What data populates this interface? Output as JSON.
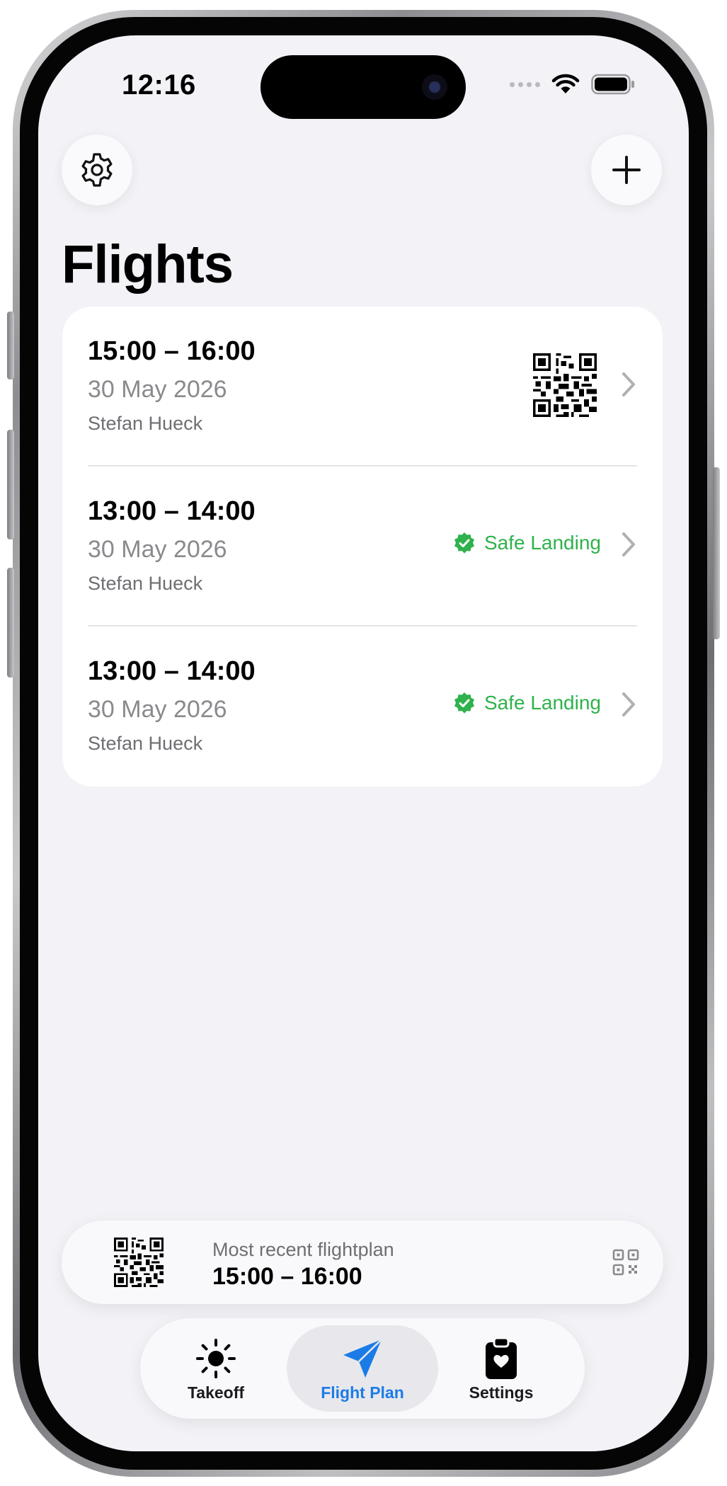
{
  "status_bar": {
    "time": "12:16"
  },
  "header": {
    "title": "Flights",
    "settings_icon": "gear-icon",
    "add_icon": "plus-icon"
  },
  "flights": [
    {
      "time": "15:00 – 16:00",
      "date": "30 May 2026",
      "pilot": "Stefan Hueck",
      "status": "",
      "indicator": "qr-code"
    },
    {
      "time": "13:00 – 14:00",
      "date": "30 May 2026",
      "pilot": "Stefan Hueck",
      "status": "Safe Landing",
      "indicator": "check-badge"
    },
    {
      "time": "13:00 – 14:00",
      "date": "30 May 2026",
      "pilot": "Stefan Hueck",
      "status": "Safe Landing",
      "indicator": "check-badge"
    }
  ],
  "recent": {
    "label": "Most recent flightplan",
    "value": "15:00 – 16:00"
  },
  "tabs": [
    {
      "label": "Takeoff",
      "icon": "sun-icon",
      "selected": false
    },
    {
      "label": "Flight Plan",
      "icon": "paper-plane-icon",
      "selected": true
    },
    {
      "label": "Settings",
      "icon": "clipboard-icon",
      "selected": false
    }
  ],
  "colors": {
    "background": "#f2f2f7",
    "accent": "#1c7ce6",
    "success": "#2fb24c",
    "secondary_text": "#8a8a8e"
  }
}
